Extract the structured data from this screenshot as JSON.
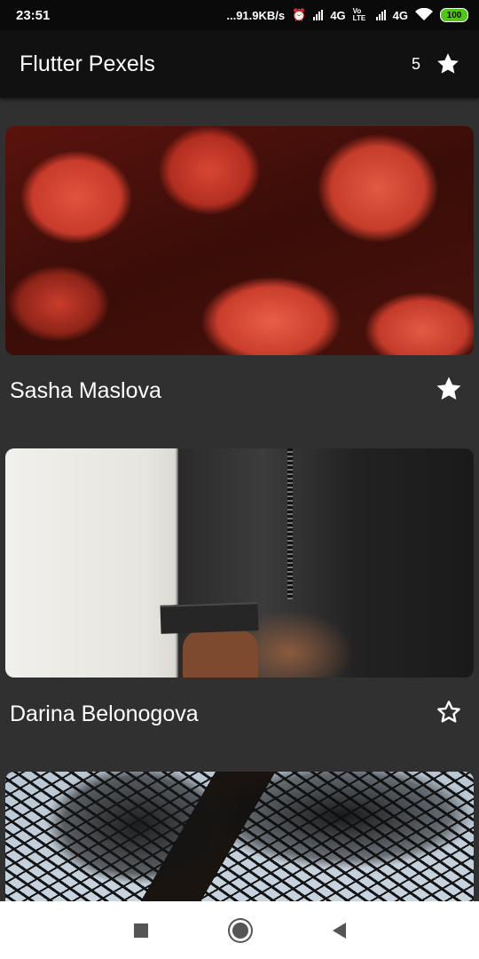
{
  "status_bar": {
    "time": "23:51",
    "network_speed": "...91.9KB/s",
    "net1": "4G",
    "volte": "Vo LTE",
    "net2": "4G",
    "battery": "100"
  },
  "app_bar": {
    "title": "Flutter Pexels",
    "favorites_count": "5",
    "favorites_icon": "star-icon"
  },
  "photos": [
    {
      "photographer": "Sasha Maslova",
      "favorite": true,
      "icon": "star-filled-icon"
    },
    {
      "photographer": "Darina Belonogova",
      "favorite": false,
      "icon": "star-outline-icon"
    },
    {
      "photographer": "",
      "favorite": null,
      "icon": ""
    }
  ],
  "nav_bar": {
    "recents_icon": "square-icon",
    "home_icon": "circle-icon",
    "back_icon": "triangle-back-icon"
  },
  "colors": {
    "background": "#303030",
    "app_bar": "#111111",
    "battery": "#52c41a"
  }
}
